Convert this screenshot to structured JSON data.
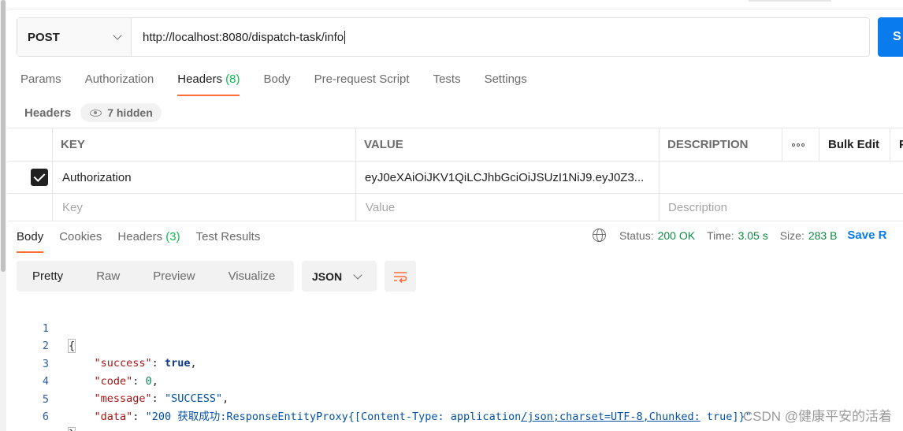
{
  "request": {
    "method": "POST",
    "url": "http://localhost:8080/dispatch-task/info",
    "send_label": "S"
  },
  "request_tabs": [
    {
      "label": "Params",
      "count": ""
    },
    {
      "label": "Authorization",
      "count": ""
    },
    {
      "label": "Headers",
      "count": "(8)"
    },
    {
      "label": "Body",
      "count": ""
    },
    {
      "label": "Pre-request Script",
      "count": ""
    },
    {
      "label": "Tests",
      "count": ""
    },
    {
      "label": "Settings",
      "count": ""
    }
  ],
  "headers_section": {
    "label": "Headers",
    "hidden_label": "7 hidden"
  },
  "headers_table": {
    "columns": {
      "key": "KEY",
      "value": "VALUE",
      "description": "DESCRIPTION",
      "bulk_edit": "Bulk Edit",
      "extra": "P"
    },
    "rows": [
      {
        "checked": true,
        "key": "Authorization",
        "value": "eyJ0eXAiOiJKV1QiLCJhbGciOiJSUzI1NiJ9.eyJ0Z3...",
        "description": ""
      }
    ],
    "placeholders": {
      "key": "Key",
      "value": "Value",
      "description": "Description"
    }
  },
  "response_tabs": [
    {
      "label": "Body",
      "count": ""
    },
    {
      "label": "Cookies",
      "count": ""
    },
    {
      "label": "Headers",
      "count": "(3)"
    },
    {
      "label": "Test Results",
      "count": ""
    }
  ],
  "response_status": {
    "status_label": "Status:",
    "status_value": "200 OK",
    "time_label": "Time:",
    "time_value": "3.05 s",
    "size_label": "Size:",
    "size_value": "283 B",
    "save_label": "Save R"
  },
  "response_view": {
    "modes": [
      "Pretty",
      "Raw",
      "Preview",
      "Visualize"
    ],
    "active_mode": "Pretty",
    "format": "JSON"
  },
  "response_body": {
    "line_numbers": [
      "1",
      "2",
      "3",
      "4",
      "5",
      "6"
    ],
    "open_brace": "{",
    "close_brace": "}",
    "success_key": "\"success\"",
    "success_value": "true",
    "code_key": "\"code\"",
    "code_value": "0",
    "message_key": "\"message\"",
    "message_value": "\"SUCCESS\"",
    "data_key": "\"data\"",
    "data_value_part1": "\"200 获取成功:ResponseEntityProxy{[Content-Type: application",
    "data_value_part2": "/json;charset=UTF-8,Chunked:",
    "data_value_part3": " true]}\""
  },
  "watermark": "CSDN @健康平安的活着",
  "colors": {
    "accent": "#ff6c37",
    "primary": "#097bed",
    "status_ok": "#0c8a42"
  }
}
